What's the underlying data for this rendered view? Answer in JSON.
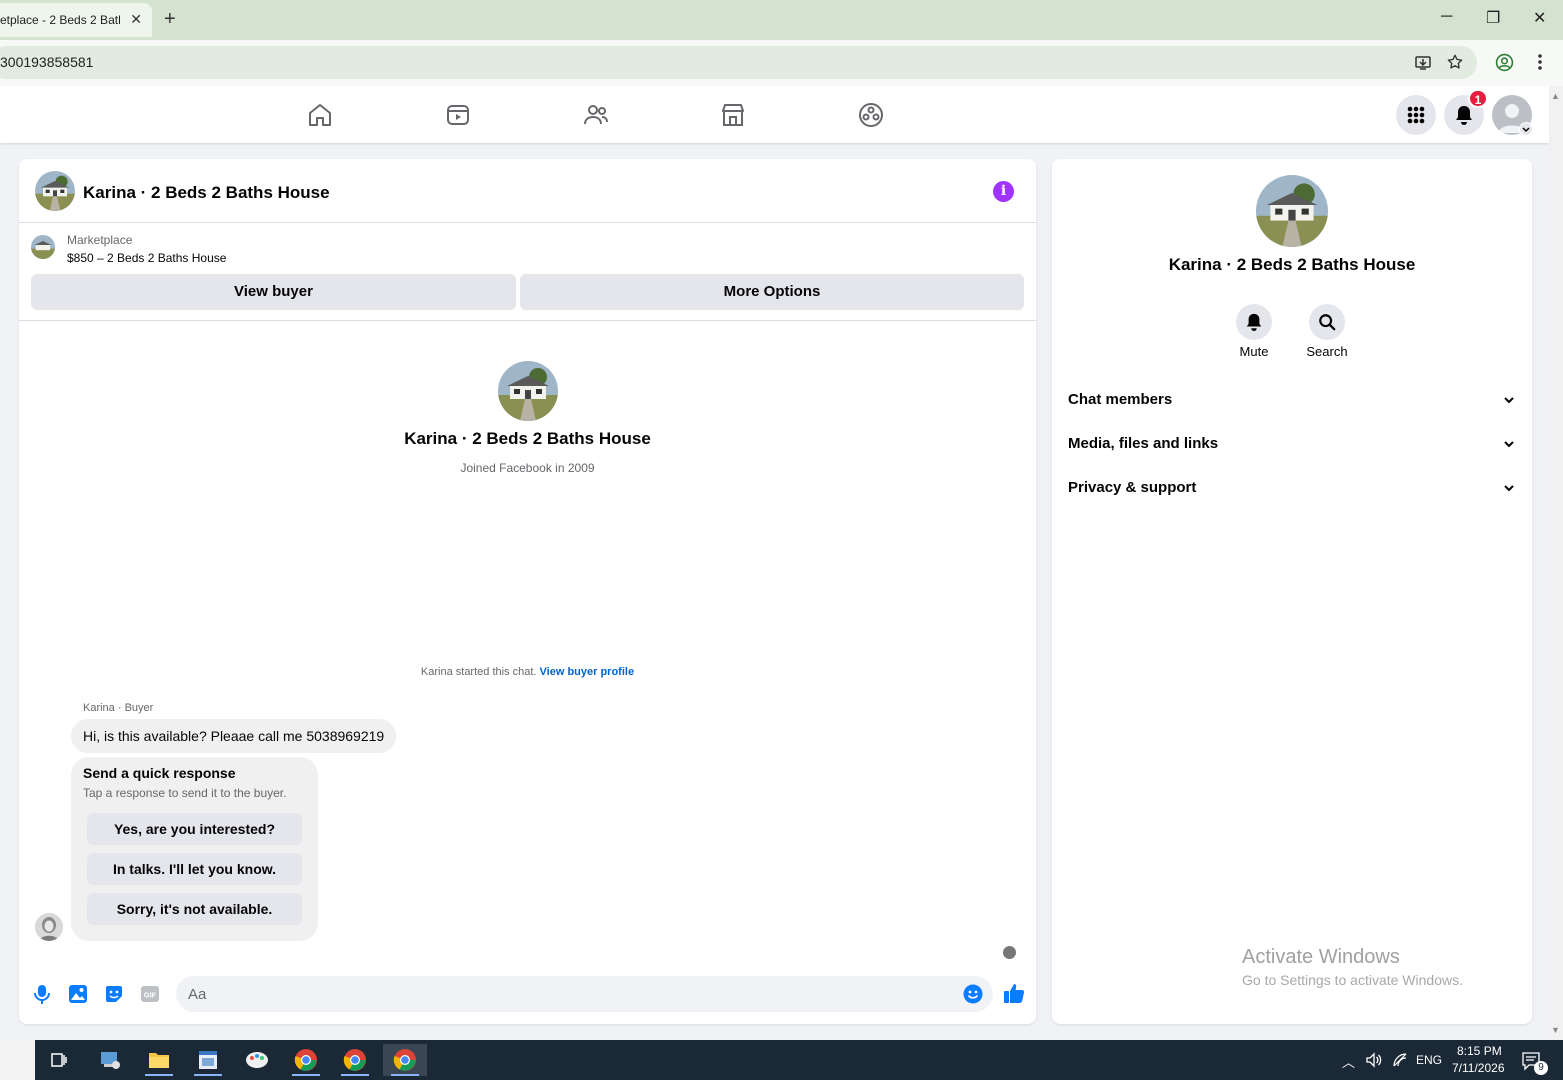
{
  "browser": {
    "tab_title": "etplace - 2 Beds 2 Bath",
    "tab_close": "✕",
    "new_tab": "+",
    "url": "300193858581",
    "window_controls": {
      "minimize": "─",
      "restore": "❐",
      "close": "✕"
    },
    "icons": [
      "install-icon",
      "star-icon",
      "profile-icon",
      "menu-icon"
    ]
  },
  "fb_nav": {
    "icons": [
      "home-icon",
      "watch-icon",
      "groups-icon",
      "marketplace-icon",
      "gaming-icon"
    ],
    "notification_count": "1",
    "right_icons": [
      "apps-grid-icon",
      "bell-icon",
      "account-avatar"
    ]
  },
  "chat": {
    "title": "Karina · 2 Beds 2 Baths House",
    "listing": {
      "category": "Marketplace",
      "name": "$850 – 2 Beds 2 Baths House"
    },
    "buttons": {
      "view_buyer": "View buyer",
      "more_options": "More Options"
    },
    "intro": {
      "name": "Karina · 2 Beds 2 Baths House",
      "joined": "Joined Facebook in 2009"
    },
    "started": {
      "text": "Karina started this chat. ",
      "link": "View buyer profile"
    },
    "message": {
      "sender": "Karina · Buyer",
      "text": "Hi, is this available? Pleaae call me 5038969219"
    },
    "quick_response": {
      "title": "Send a quick response",
      "subtitle": "Tap a response to send it to the buyer.",
      "options": [
        "Yes, are you interested?",
        "In talks. I'll let you know.",
        "Sorry, it's not available."
      ]
    },
    "composer": {
      "placeholder": "Aa",
      "icons": [
        "microphone-icon",
        "image-icon",
        "sticker-icon",
        "gif-icon",
        "emoji-icon",
        "like-icon"
      ],
      "gif_label": "GIF"
    }
  },
  "side_panel": {
    "name": "Karina · 2 Beds 2 Baths House",
    "actions": [
      {
        "label": "Mute",
        "icon": "bell-icon"
      },
      {
        "label": "Search",
        "icon": "search-icon"
      }
    ],
    "sections": [
      "Chat members",
      "Media, files and links",
      "Privacy & support"
    ]
  },
  "watermark": {
    "title": "Activate Windows",
    "subtitle": "Go to Settings to activate Windows."
  },
  "taskbar": {
    "apps": [
      "task-view-icon",
      "app-icon",
      "file-explorer-icon",
      "app-window-icon",
      "paint-icon",
      "chrome-icon",
      "chrome-icon",
      "chrome-icon"
    ],
    "lang": "ENG",
    "time": "8:15 PM",
    "date": "7/11/2026",
    "notification_count": "9"
  },
  "colors": {
    "accent": "#0064d1",
    "info": "#a033ff",
    "badge": "#e41e3f",
    "like": "#0a7cff"
  }
}
